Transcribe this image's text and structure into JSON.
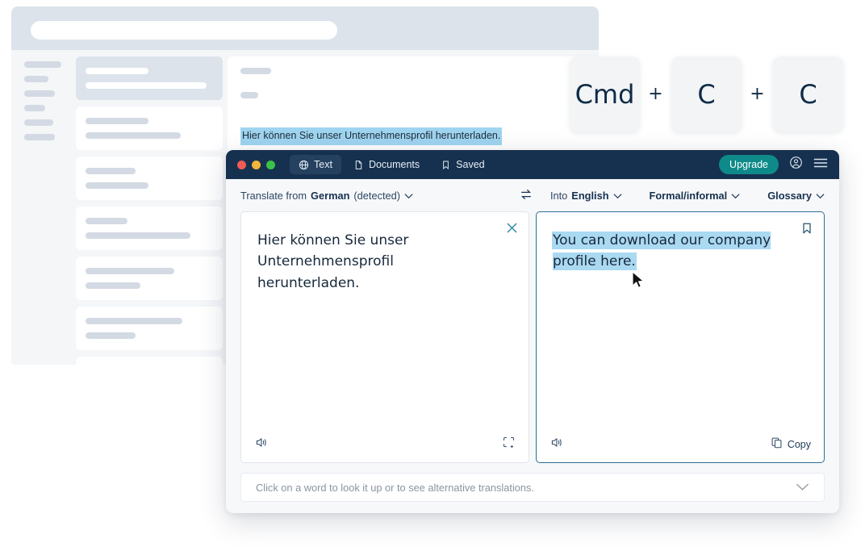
{
  "background_mockup": {
    "name": "background-app-mockup",
    "selected_sentence": "Hier können Sie unser Unternehmensprofil herunterladen."
  },
  "shortcut": {
    "keys": [
      "Cmd",
      "C",
      "C"
    ],
    "separator": "+"
  },
  "app": {
    "titlebar": {
      "tabs": [
        {
          "label": "Text",
          "icon": "globe-icon",
          "active": true
        },
        {
          "label": "Documents",
          "icon": "document-icon",
          "active": false
        },
        {
          "label": "Saved",
          "icon": "bookmark-icon",
          "active": false
        }
      ],
      "upgrade_label": "Upgrade",
      "account_icon": "account-circle-icon",
      "menu_icon": "hamburger-menu-icon",
      "accent_color": "#0f8a8a",
      "background_color": "#16314f"
    },
    "langbar": {
      "source_prefix": "Translate from",
      "source_language": "German",
      "source_suffix": "(detected)",
      "swap_icon": "swap-arrows-icon",
      "target_prefix": "Into",
      "target_language": "English",
      "formality_label": "Formal/informal",
      "glossary_label": "Glossary",
      "caret": "⌄"
    },
    "source_panel": {
      "text": "Hier können Sie unser Unternehmensprofil herunterladen.",
      "close_icon": "close-icon",
      "speak_icon": "speaker-icon",
      "scan_icon": "select-area-icon"
    },
    "target_panel": {
      "text": "You can download our company profile here.",
      "highlighted": true,
      "highlight_color": "#aad9f2",
      "bookmark_icon": "bookmark-icon",
      "speak_icon": "speaker-icon",
      "copy_icon": "copy-icon",
      "copy_label": "Copy",
      "border_color": "#2b6e93"
    },
    "hintbar": {
      "text": "Click on a word to look it up or to see alternative translations.",
      "chevron_icon": "chevron-down-icon"
    }
  }
}
